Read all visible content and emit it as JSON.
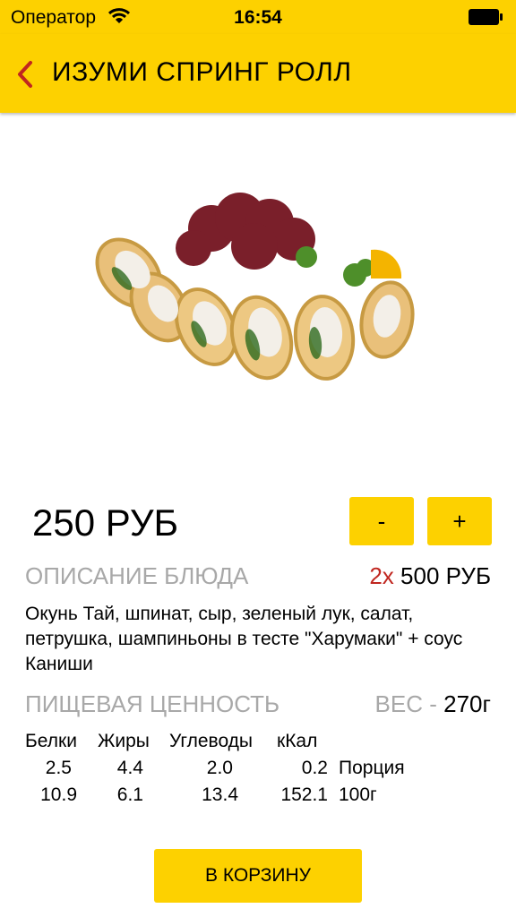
{
  "status": {
    "carrier": "Оператор",
    "time": "16:54"
  },
  "nav": {
    "title": "ИЗУМИ СПРИНГ РОЛЛ",
    "back_icon": "chevron-left-icon"
  },
  "product": {
    "price": "250 РУБ",
    "minus_label": "-",
    "plus_label": "+"
  },
  "description": {
    "label": "ОПИСАНИЕ БЛЮДА",
    "text": "Окунь Тай, шпинат, сыр, зеленый лук, салат, петрушка, шампиньоны в тесте \"Харумаки\" + соус Каниши"
  },
  "total": {
    "qty": "2х",
    "amount": "500 РУБ"
  },
  "nutrition": {
    "label": "ПИЩЕВАЯ ЦЕННОСТЬ",
    "weight_label": "ВЕС -",
    "weight_value": "270г",
    "headers": [
      "Белки",
      "Жиры",
      "Углеводы",
      "кКал"
    ],
    "rows": [
      {
        "values": [
          "2.5",
          "4.4",
          "2.0",
          "0.2"
        ],
        "unit": "Порция"
      },
      {
        "values": [
          "10.9",
          "6.1",
          "13.4",
          "152.1"
        ],
        "unit": "100г"
      }
    ]
  },
  "cart_button": "В КОРЗИНУ",
  "colors": {
    "accent": "#fdd100",
    "qty_red": "#c0261f",
    "muted": "#a8a8a8"
  }
}
